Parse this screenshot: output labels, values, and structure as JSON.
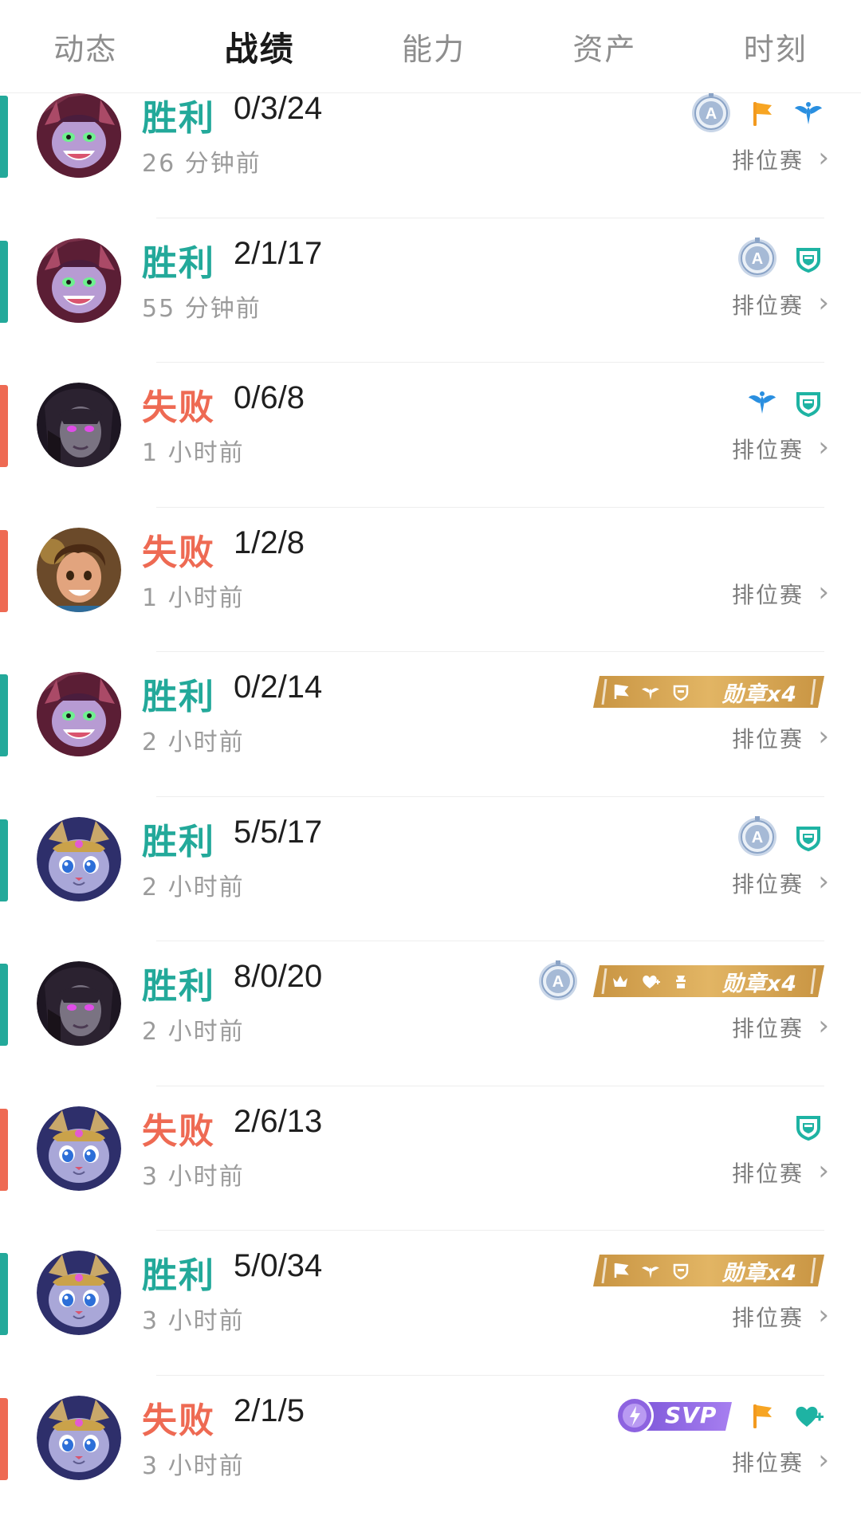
{
  "tabs": [
    {
      "label": "动态",
      "active": false
    },
    {
      "label": "战绩",
      "active": true
    },
    {
      "label": "能力",
      "active": false
    },
    {
      "label": "资产",
      "active": false
    },
    {
      "label": "时刻",
      "active": false
    }
  ],
  "colors": {
    "win": "#23a99a",
    "loss": "#ee6a53",
    "medal_gold": "#d9a84e",
    "svp_purple": "#8d63e0"
  },
  "matches": [
    {
      "result": "胜利",
      "kda": "0/3/24",
      "time": "26 分钟前",
      "mode": "排位赛",
      "outcome": "win",
      "champion_avatar": "purple-yordle-avatar",
      "badges": [
        "a-medal-icon",
        "flag-icon",
        "wings-icon"
      ]
    },
    {
      "result": "胜利",
      "kda": "2/1/17",
      "time": "55 分钟前",
      "mode": "排位赛",
      "outcome": "win",
      "champion_avatar": "purple-yordle-avatar",
      "badges": [
        "a-medal-icon",
        "shield-icon"
      ]
    },
    {
      "result": "失败",
      "kda": "0/6/8",
      "time": "1 小时前",
      "mode": "排位赛",
      "outcome": "loss",
      "champion_avatar": "dark-mage-avatar",
      "badges": [
        "wings-icon",
        "shield-icon"
      ]
    },
    {
      "result": "失败",
      "kda": "1/2/8",
      "time": "1 小时前",
      "mode": "排位赛",
      "outcome": "loss",
      "champion_avatar": "young-hero-avatar",
      "badges": []
    },
    {
      "result": "胜利",
      "kda": "0/2/14",
      "time": "2 小时前",
      "mode": "排位赛",
      "outcome": "win",
      "champion_avatar": "purple-yordle-avatar",
      "medal": {
        "label": "勋章x4",
        "icons": [
          "flag-icon",
          "wings-icon",
          "shield-icon"
        ]
      }
    },
    {
      "result": "胜利",
      "kda": "5/5/17",
      "time": "2 小时前",
      "mode": "排位赛",
      "outcome": "win",
      "champion_avatar": "cat-avatar",
      "badges": [
        "a-medal-icon",
        "shield-icon"
      ]
    },
    {
      "result": "胜利",
      "kda": "8/0/20",
      "time": "2 小时前",
      "mode": "排位赛",
      "outcome": "win",
      "champion_avatar": "dark-mage-avatar",
      "badges": [
        "a-medal-icon"
      ],
      "medal": {
        "label": "勋章x4",
        "icons": [
          "crown-icon",
          "heart-plus-icon",
          "tower-icon"
        ]
      }
    },
    {
      "result": "失败",
      "kda": "2/6/13",
      "time": "3 小时前",
      "mode": "排位赛",
      "outcome": "loss",
      "champion_avatar": "cat-avatar",
      "badges": [
        "shield-icon"
      ]
    },
    {
      "result": "胜利",
      "kda": "5/0/34",
      "time": "3 小时前",
      "mode": "排位赛",
      "outcome": "win",
      "champion_avatar": "cat-avatar",
      "medal": {
        "label": "勋章x4",
        "icons": [
          "flag-icon",
          "wings-icon",
          "shield-icon"
        ]
      }
    },
    {
      "result": "失败",
      "kda": "2/1/5",
      "time": "3 小时前",
      "mode": "排位赛",
      "outcome": "loss",
      "champion_avatar": "cat-avatar",
      "svp": "SVP",
      "badges": [
        "flag-icon",
        "heart-plus-icon"
      ]
    }
  ]
}
